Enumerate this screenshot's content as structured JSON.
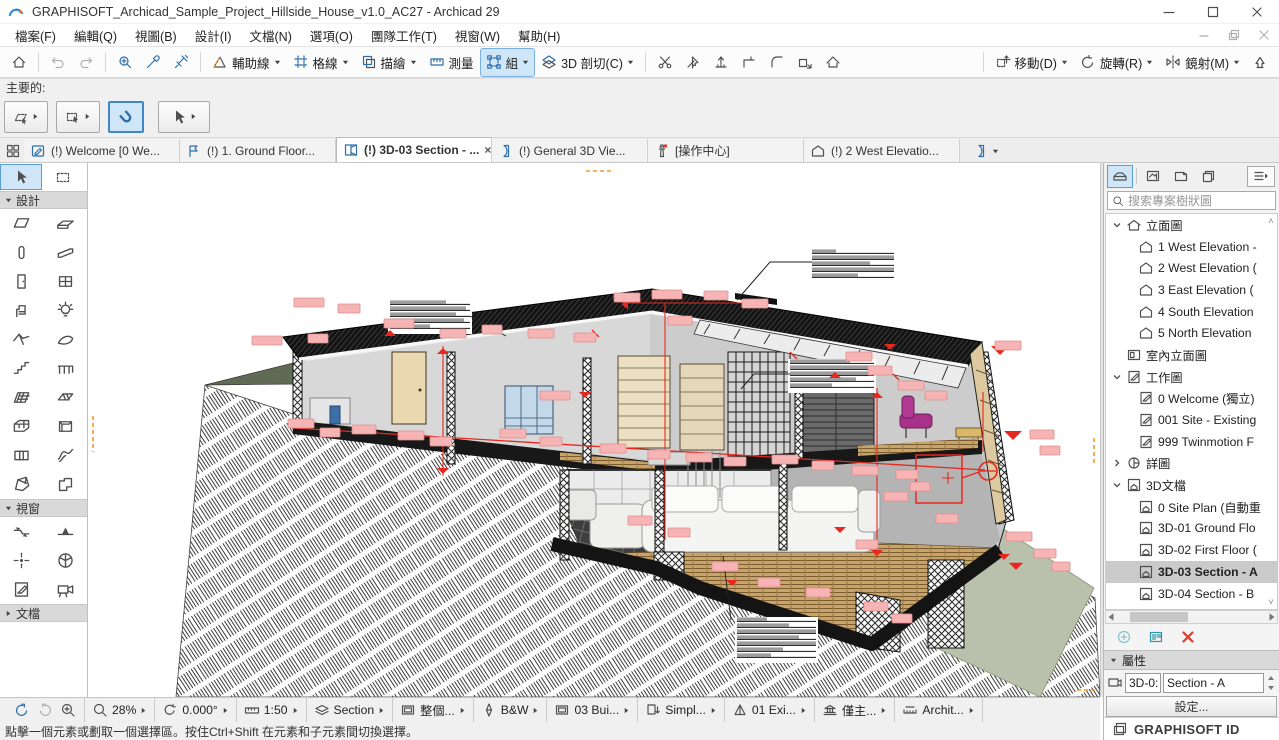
{
  "window": {
    "title": "GRAPHISOFT_Archicad_Sample_Project_Hillside_House_v1.0_AC27 - Archicad 29",
    "controls": [
      "minimize",
      "maximize",
      "close"
    ],
    "doc_controls": [
      "minimize-doc",
      "restore-doc",
      "close-doc"
    ]
  },
  "menu_bar": {
    "items": [
      "檔案(F)",
      "編輯(Q)",
      "視圖(B)",
      "設計(I)",
      "文檔(N)",
      "選項(O)",
      "團隊工作(T)",
      "視窗(W)",
      "幫助(H)"
    ]
  },
  "toolbar": {
    "labels": [
      "輔助線",
      "格線",
      "描繪",
      "測量",
      "組",
      "3D 剖切(C)",
      "移動(D)",
      "旋轉(R)",
      "鏡射(M)"
    ]
  },
  "info_bar": {
    "label": "主要的:"
  },
  "tab_bar": {
    "tabs": [
      "(!) Welcome [0 We...",
      "(!) 1. Ground Floor...",
      "(!) 3D-03 Section - ...",
      "(!) General 3D Vie...",
      "[操作中心]",
      "(!) 2 West Elevatio..."
    ],
    "active_index": 2
  },
  "toolbox": {
    "sections": [
      "設計",
      "視窗",
      "文檔"
    ]
  },
  "navigator": {
    "search_placeholder": "搜索專案樹狀圖",
    "tree": [
      {
        "label": "立面圖",
        "depth": 0,
        "icon": "elevfolder",
        "state": "expanded"
      },
      {
        "label": "1 West Elevation -",
        "depth": 1,
        "icon": "elevhouse"
      },
      {
        "label": "2 West Elevation (",
        "depth": 1,
        "icon": "elevhouse"
      },
      {
        "label": "3 East Elevation (",
        "depth": 1,
        "icon": "elevhouse"
      },
      {
        "label": "4 South Elevation",
        "depth": 1,
        "icon": "elevhouse"
      },
      {
        "label": "5 North Elevation",
        "depth": 1,
        "icon": "elevhouse"
      },
      {
        "label": "室內立面圖",
        "depth": 0,
        "icon": "interior",
        "state": "none"
      },
      {
        "label": "工作圖",
        "depth": 0,
        "icon": "wksheet",
        "state": "expanded"
      },
      {
        "label": "0 Welcome (獨立)",
        "depth": 1,
        "icon": "wksheet"
      },
      {
        "label": "001 Site - Existing",
        "depth": 1,
        "icon": "wksheet"
      },
      {
        "label": "999 Twinmotion F",
        "depth": 1,
        "icon": "wksheet"
      },
      {
        "label": "詳圖",
        "depth": 0,
        "icon": "detail",
        "state": "collapsed"
      },
      {
        "label": "3D文檔",
        "depth": 0,
        "icon": "doc3d",
        "state": "expanded"
      },
      {
        "label": "0 Site Plan (自動重",
        "depth": 1,
        "icon": "doc3d"
      },
      {
        "label": "3D-01 Ground Flo",
        "depth": 1,
        "icon": "doc3d"
      },
      {
        "label": "3D-02 First Floor (",
        "depth": 1,
        "icon": "doc3d"
      },
      {
        "label": "3D-03 Section - A",
        "depth": 1,
        "icon": "doc3d",
        "selected": true
      },
      {
        "label": "3D-04 Section - B",
        "depth": 1,
        "icon": "doc3d"
      }
    ],
    "properties": {
      "header": "屬性",
      "id_value": "3D-0:",
      "name_value": "Section - A",
      "settings_label": "設定..."
    },
    "brand": "GRAPHISOFT ID"
  },
  "quick_options": {
    "values": [
      "28%",
      "0.000°",
      "1:50",
      "Section",
      "整個...",
      "B&W",
      "03 Bui...",
      "Simpl...",
      "01 Exi...",
      "僅主...",
      "Archit..."
    ]
  },
  "status_bar": {
    "message": "點擊一個元素或劃取一個選擇區。按住Ctrl+Shift 在元素和子元素間切換選擇。"
  },
  "colors": {
    "selection_blue": "#cfe6f8",
    "icon_blue": "#2e6fad",
    "markup_red": "#e8281e",
    "markup_pink": "#f7b4b4",
    "terrain_green": "#b9c1ad",
    "delete_red": "#e23b2e",
    "teal": "#2b98a6"
  }
}
